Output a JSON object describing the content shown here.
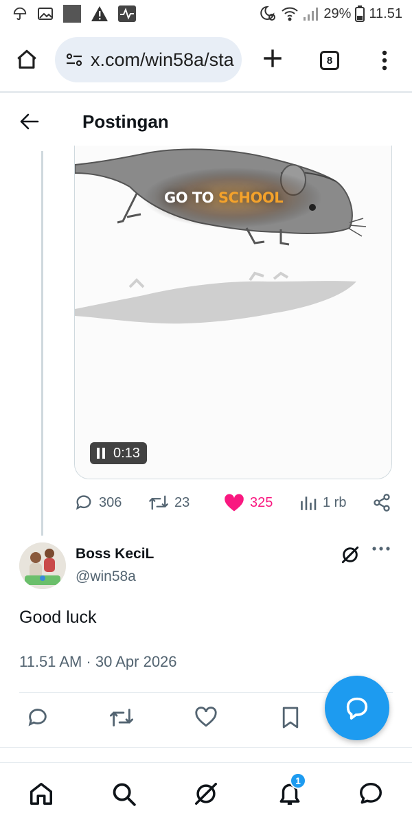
{
  "status_bar": {
    "battery": "29%",
    "time": "11.51",
    "icons": [
      "umbrella-icon",
      "image-icon",
      "square-icon",
      "warning-icon",
      "activity-icon",
      "moon-alarm-icon",
      "wifi-icon",
      "signal-icon",
      "battery-icon"
    ]
  },
  "browser": {
    "url": "x.com/win58a/sta",
    "tab_count": "8"
  },
  "header": {
    "title": "Postingan"
  },
  "media": {
    "overlay_text_1": "GO TO",
    "overlay_text_2": "SCHOOL",
    "time": "0:13"
  },
  "post_actions": {
    "replies": "306",
    "reposts": "23",
    "likes": "325",
    "views": "1 rb",
    "like_color": "#f91880"
  },
  "reply": {
    "name": "Boss KeciL",
    "handle": "@win58a",
    "text": "Good luck",
    "meta": "11.51 AM · 30 Apr 2026"
  },
  "bottom_nav": {
    "notification_count": "1"
  },
  "colors": {
    "accent": "#1d9bf0",
    "muted": "#536471"
  }
}
